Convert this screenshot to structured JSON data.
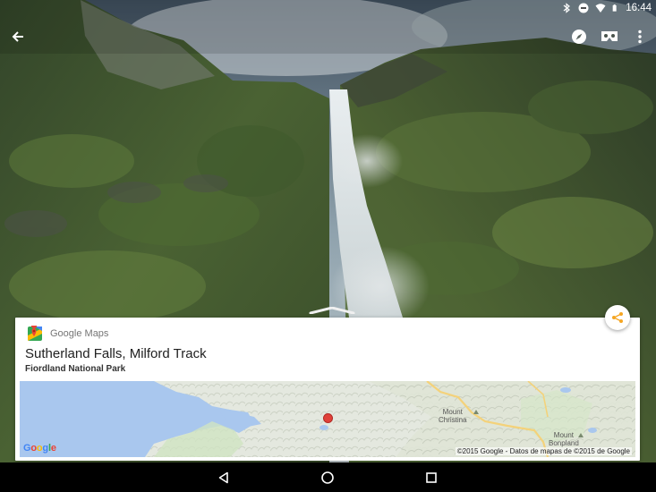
{
  "status_bar": {
    "time": "16:44",
    "icons": [
      "bluetooth-icon",
      "do-not-disturb-icon",
      "wifi-icon",
      "battery-icon"
    ]
  },
  "toolbar": {
    "icons": [
      "back-arrow-icon",
      "compass-icon",
      "cardboard-vr-icon",
      "more-vert-icon"
    ]
  },
  "card": {
    "brand_label": "Google Maps",
    "title": "Sutherland Falls, Milford Track",
    "subtitle": "Fiordland National Park",
    "share_icon": "share-icon"
  },
  "map": {
    "labels": {
      "mount_christina": "Mount\nChristina",
      "mount_bonpland": "Mount\nBonpland"
    },
    "logo_text": "Google",
    "copyright": "©2015 Google - Datos de mapas de ©2015 de Google",
    "marker_color": "#e0413a"
  },
  "nav_bar": {
    "icons": [
      "back-triangle-icon",
      "home-circle-icon",
      "recents-square-icon"
    ]
  }
}
